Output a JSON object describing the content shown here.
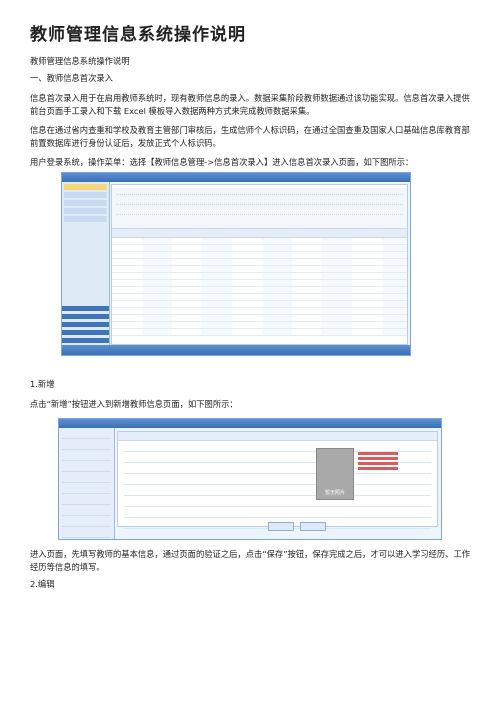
{
  "title": "教师管理信息系统操作说明",
  "paragraphs": {
    "subtitle": "教师管理信息系统操作说明",
    "section1": "一、教师信息首次录入",
    "intro1": "信息首次录入用于在启用教师系统时，现有教师信息的录入。数据采集阶段教师数据通过该功能实现。信息首次录入提供前台页面手工录入和下载 Excel 模板导入数据两种方式来完成教师数据采集。",
    "intro2": "信息在通过省内查重和学校及教育主管部门审核后，生成信师个人标识码，在通过全国查重及国家人口基础信息库教育部前置数据库进行身份认证后，发放正式个人标识码。",
    "nav": "用户登录系统，操作菜单：选择【教师信息管理->信息首次录入】进入信息首次录入页面，如下图所示：",
    "sub1": "1.新增",
    "add_desc": "点击“新增”按钮进入到新增教师信息页面，如下图所示：",
    "after_add": "进入页面，先填写教师的基本信息，通过页面的验证之后，点击“保存”按钮，保存完成之后，才可以进入学习经历、工作经历等信息的填写。",
    "sub2": "2.编辑"
  },
  "figure2_photo_label": "暂无照片",
  "colors": {
    "accent": "#3a6fb6",
    "highlight": "#f7d77a",
    "warning": "#d85c5c"
  }
}
